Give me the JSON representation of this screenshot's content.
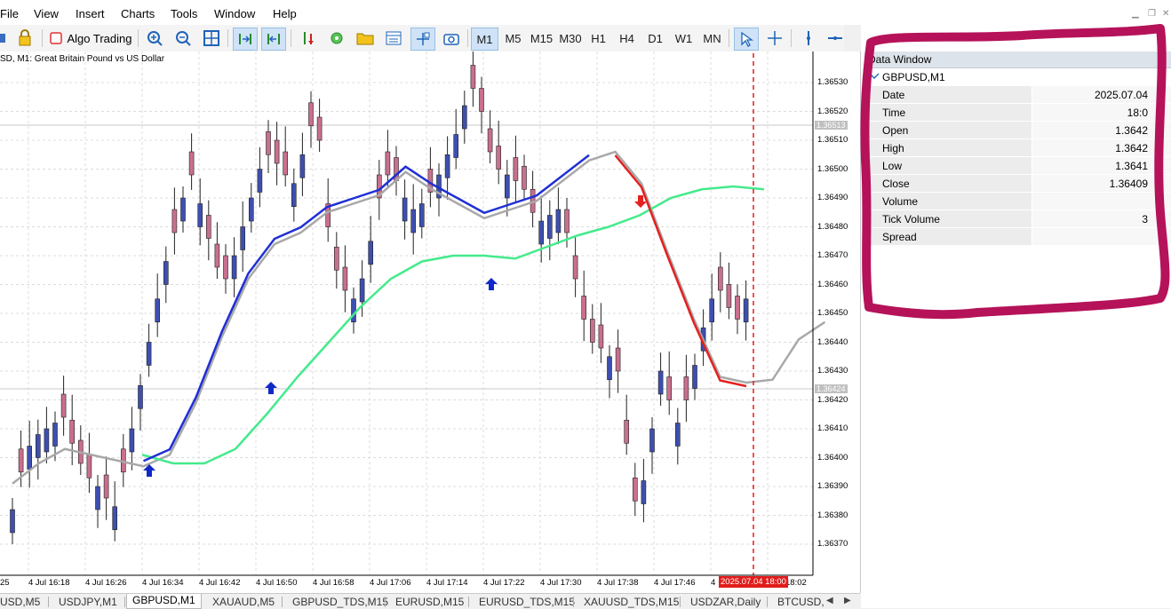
{
  "menu": [
    "File",
    "View",
    "Insert",
    "Charts",
    "Tools",
    "Window",
    "Help"
  ],
  "toolbar": {
    "algo_trading": "Algo Trading",
    "timeframes": [
      "M1",
      "M5",
      "M15",
      "M30",
      "H1",
      "H4",
      "D1",
      "W1",
      "MN"
    ],
    "active_timeframe": "M1"
  },
  "chart": {
    "title": "SD, M1:  Great Britain Pound vs US Dollar",
    "price_labels": [
      "1.36530",
      "1.36520",
      "1.36510",
      "1.36500",
      "1.36490",
      "1.36480",
      "1.36470",
      "1.36460",
      "1.36450",
      "1.36440",
      "1.36430",
      "1.36420",
      "1.36410",
      "1.36400",
      "1.36390",
      "1.36380",
      "1.36370"
    ],
    "price_tags": [
      "1.36513",
      "1.36424"
    ],
    "time_labels": [
      "25",
      "4 Jul 16:18",
      "4 Jul 16:26",
      "4 Jul 16:34",
      "4 Jul 16:42",
      "4 Jul 16:50",
      "4 Jul 16:58",
      "4 Jul 17:06",
      "4 Jul 17:14",
      "4 Jul 17:22",
      "4 Jul 17:30",
      "4 Jul 17:38",
      "4 Jul 17:46",
      "4",
      "18:02"
    ],
    "cursor_time": "2025.07.04 18:00",
    "colors": {
      "bull_candle": "#3e4fb0",
      "bear_candle": "#c96f8f",
      "ma_fast": "#1f2fd6",
      "ma_slow": "#44ea8c",
      "ma_gray": "#a8a8a8",
      "signal_down": "#e52020",
      "signal_up": "#1128c8",
      "highlight": "#b5125a"
    },
    "chart_data": {
      "type": "line",
      "symbol": "GBPUSD",
      "timeframe": "M1",
      "ylim": [
        1.36365,
        1.36535
      ],
      "series": [
        {
          "values": [
            1.36391,
            1.36398,
            1.36403,
            1.36401,
            1.36399,
            1.36397,
            1.36401,
            1.36419,
            1.36442,
            1.36462,
            1.36474,
            1.36478,
            1.36485,
            1.36488,
            1.36491,
            1.36499,
            1.36493,
            1.36488,
            1.36483,
            1.36486,
            1.36489,
            1.36496,
            1.36503,
            1.36506,
            1.36495,
            1.36471,
            1.36448,
            1.36428,
            1.36426,
            1.36427,
            1.36441,
            1.36447
          ]
        },
        {
          "values": [
            1.36401,
            1.36398,
            1.36398,
            1.36403,
            1.36415,
            1.36428,
            1.3644,
            1.36452,
            1.36462,
            1.36468,
            1.3647,
            1.3647,
            1.36469,
            1.36473,
            1.36477,
            1.3648,
            1.36484,
            1.3649,
            1.36493,
            1.36494,
            1.36493
          ]
        }
      ]
    }
  },
  "data_window": {
    "title": "Data Window",
    "symbol": "GBPUSD,M1",
    "rows": [
      {
        "label": "Date",
        "value": "2025.07.04"
      },
      {
        "label": "Time",
        "value": "18:0"
      },
      {
        "label": "Open",
        "value": "1.3642"
      },
      {
        "label": "High",
        "value": "1.3642"
      },
      {
        "label": "Low",
        "value": "1.3641"
      },
      {
        "label": "Close",
        "value": "1.36409"
      },
      {
        "label": "Volume",
        "value": ""
      },
      {
        "label": "Tick Volume",
        "value": "3"
      },
      {
        "label": "Spread",
        "value": ""
      }
    ]
  },
  "tabs": [
    "USD,M5",
    "USDJPY,M1",
    "GBPUSD,M1",
    "XAUAUD,M5",
    "GBPUSD_TDS,M15",
    "EURUSD,M15",
    "EURUSD_TDS,M15",
    "XAUUSD_TDS,M15",
    "USDZAR,Daily",
    "BTCUSD,"
  ],
  "active_tab": "GBPUSD,M1"
}
